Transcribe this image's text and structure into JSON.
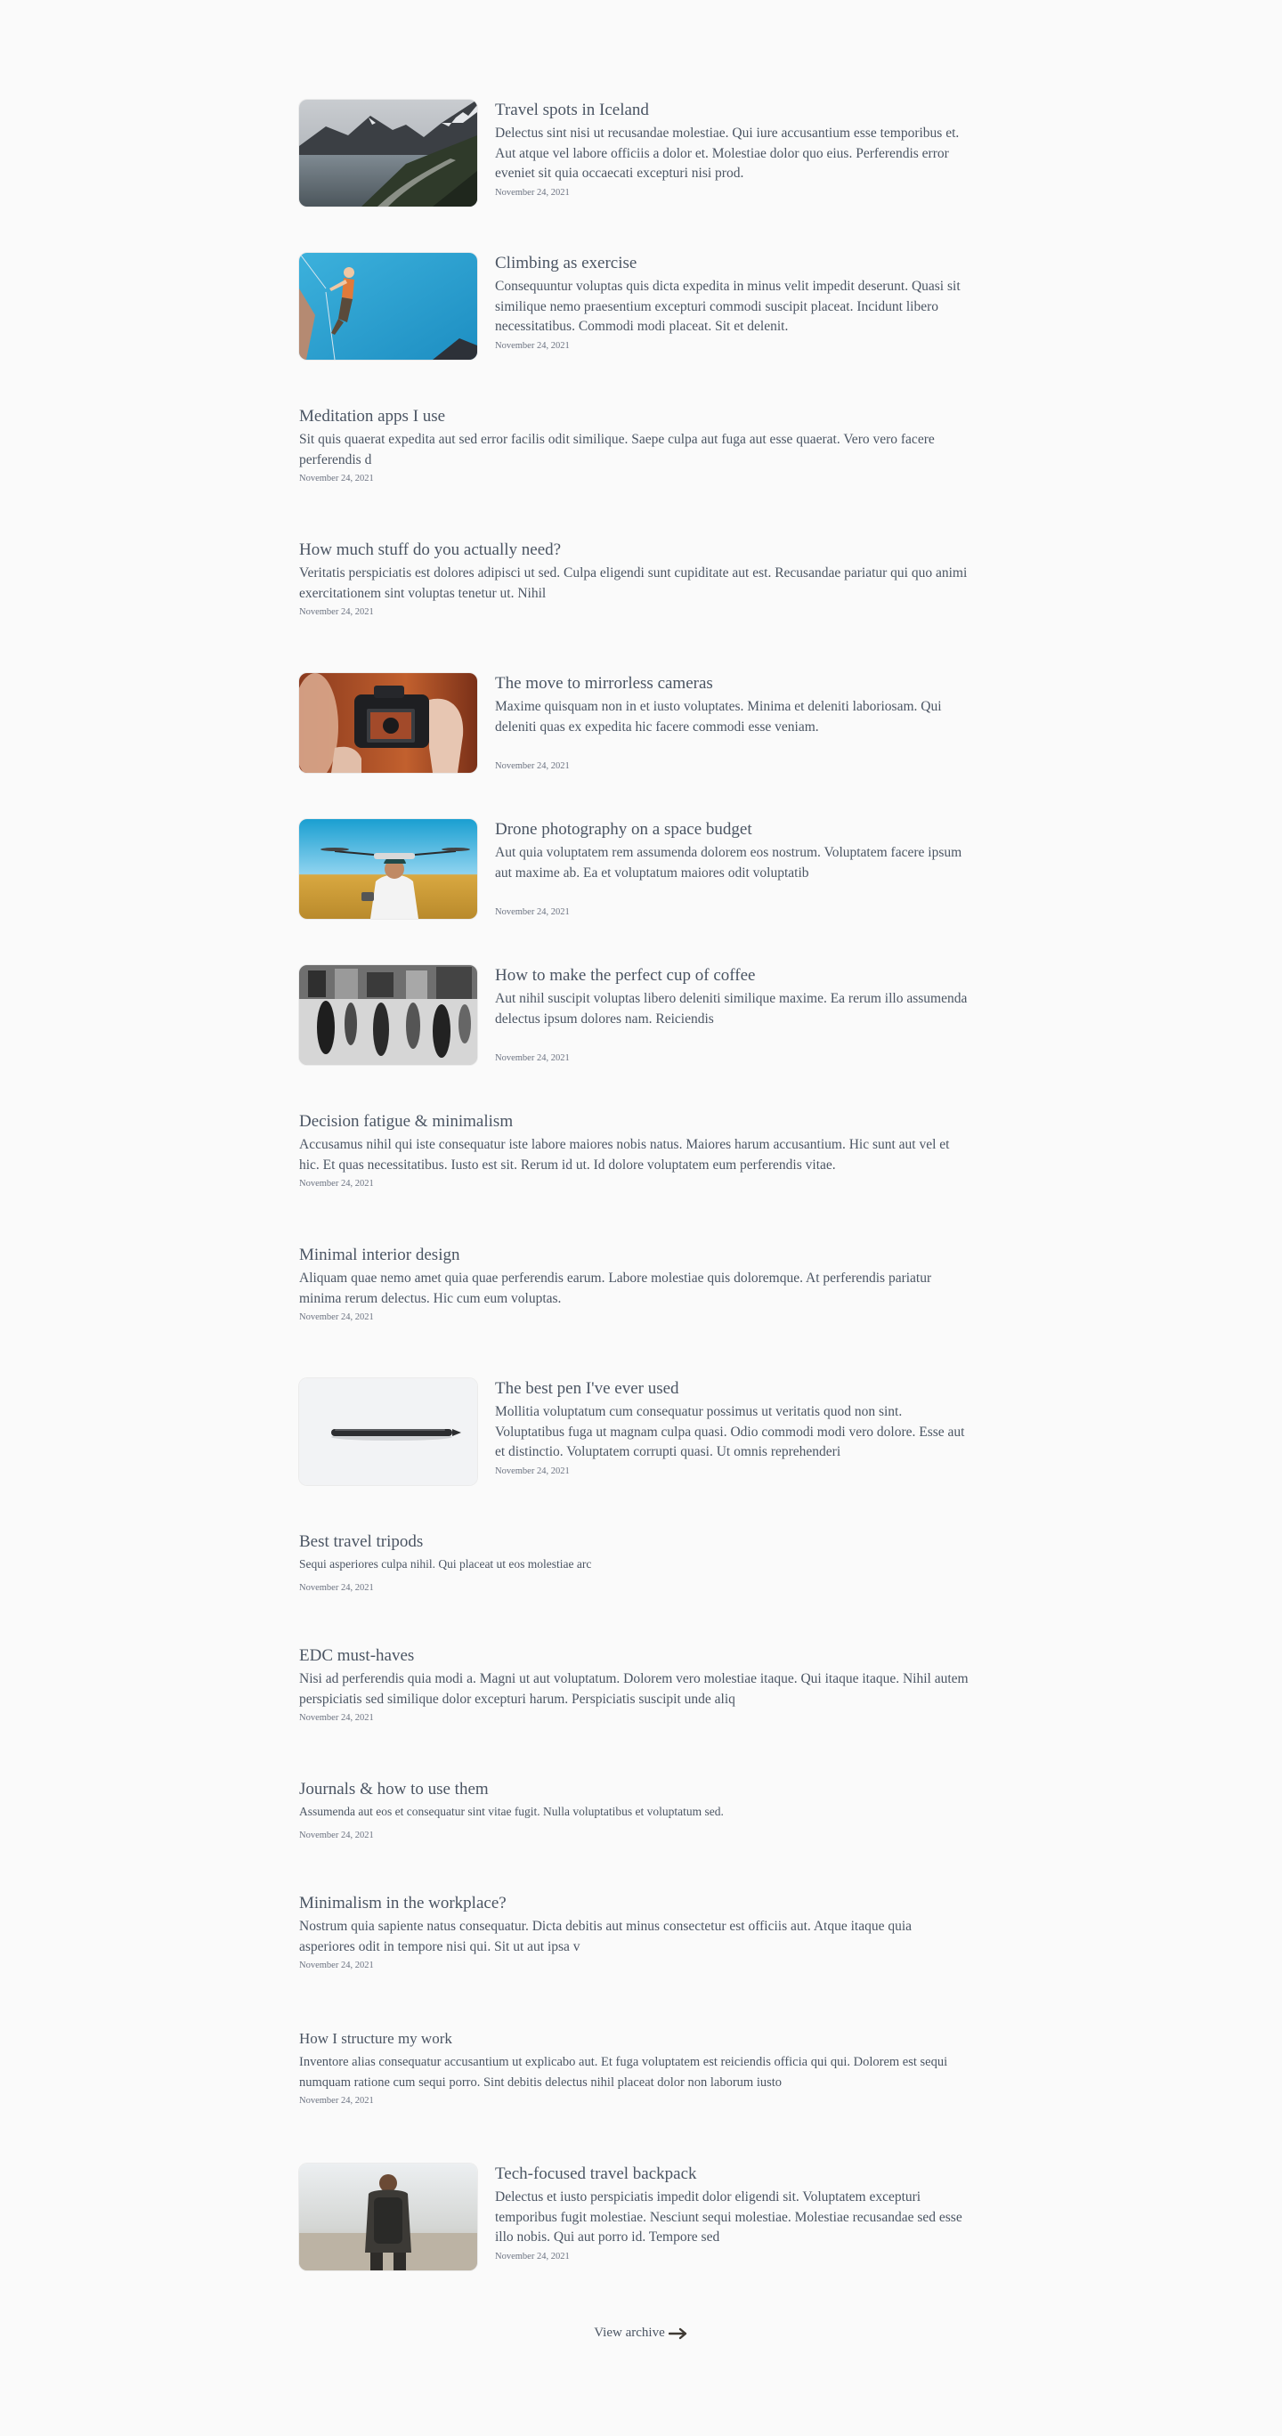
{
  "posts": [
    {
      "title": "Travel spots in Iceland",
      "excerpt": "Delectus sint nisi ut recusandae molestiae. Qui iure accusantium esse temporibus et. Aut atque vel labore officiis a dolor et. Molestiae dolor quo eius. Perferendis error eveniet sit quia occaecati excepturi nisi prod.",
      "date": "November 24, 2021",
      "image": "iceland-mountain-road"
    },
    {
      "title": "Climbing as exercise",
      "excerpt": "Consequuntur voluptas quis dicta expedita in minus velit impedit deserunt. Quasi sit similique nemo praesentium excepturi commodi suscipit placeat. Incidunt libero necessitatibus. Commodi modi placeat. Sit et delenit.",
      "date": "November 24, 2021",
      "image": "rock-climber"
    },
    {
      "title": "Meditation apps I use",
      "excerpt": "Sit quis quaerat expedita aut sed error facilis odit similique. Saepe culpa aut fuga aut esse quaerat. Vero vero facere perferendis d",
      "date": "November 24, 2021"
    },
    {
      "title": "How much stuff do you actually need?",
      "excerpt": "Veritatis perspiciatis est dolores adipisci ut sed. Culpa eligendi sunt cupiditate aut est. Recusandae pariatur qui quo animi exercitationem sint voluptas tenetur ut. Nihil",
      "date": "November 24, 2021"
    },
    {
      "title": "The move to mirrorless cameras",
      "excerpt": "Maxime quisquam non in et iusto voluptates. Minima et deleniti laboriosam. Qui deleniti quas ex expedita hic facere commodi esse veniam.",
      "date": "November 24, 2021",
      "image": "mirrorless-camera"
    },
    {
      "title": "Drone photography on a space budget",
      "excerpt": "Aut quia voluptatem rem assumenda dolorem eos nostrum. Voluptatem facere ipsum aut maxime ab. Ea et voluptatum maiores odit voluptatib",
      "date": "November 24, 2021",
      "image": "drone-pilot"
    },
    {
      "title": "How to make the perfect cup of coffee",
      "excerpt": "Aut nihil suscipit voluptas libero deleniti similique maxime. Ea rerum illo assumenda delectus ipsum dolores nam. Reiciendis",
      "date": "November 24, 2021",
      "image": "busy-street"
    },
    {
      "title": "Decision fatigue & minimalism",
      "excerpt": "Accusamus nihil qui iste consequatur iste labore maiores nobis natus. Maiores harum accusantium. Hic sunt aut vel et hic. Et quas necessitatibus. Iusto est sit. Rerum id ut. Id dolore voluptatem eum perferendis vitae.",
      "date": "November 24, 2021"
    },
    {
      "title": "Minimal interior design",
      "excerpt": "Aliquam quae nemo amet quia quae perferendis earum. Labore molestiae quis doloremque. At perferendis pariatur minima rerum delectus. Hic cum eum voluptas.",
      "date": "November 24, 2021"
    },
    {
      "title": "The best pen I've ever used",
      "excerpt": "Mollitia voluptatum cum consequatur possimus ut veritatis quod non sint. Voluptatibus fuga ut magnam culpa quasi. Odio commodi modi vero dolore. Esse aut et distinctio. Voluptatem corrupti quasi. Ut omnis reprehenderi",
      "date": "November 24, 2021",
      "image": "pen"
    },
    {
      "title": "Best travel tripods",
      "excerpt": "Sequi asperiores culpa nihil. Qui placeat ut eos molestiae arc",
      "date": "November 24, 2021"
    },
    {
      "title": "EDC must-haves",
      "excerpt": "Nisi ad perferendis quia modi a. Magni ut aut voluptatum. Dolorem vero molestiae itaque. Qui itaque itaque. Nihil autem perspiciatis sed similique dolor excepturi harum. Perspiciatis suscipit unde aliq",
      "date": "November 24, 2021"
    },
    {
      "title": "Journals & how to use them",
      "excerpt": "Assumenda aut eos et consequatur sint vitae fugit. Nulla voluptatibus et voluptatum sed.",
      "date": "November 24, 2021"
    },
    {
      "title": "Minimalism in the workplace?",
      "excerpt": "Nostrum quia sapiente natus consequatur. Dicta debitis aut minus consectetur est officiis aut. Atque itaque quia asperiores odit in tempore nisi qui. Sit ut aut ipsa v",
      "date": "November 24, 2021"
    },
    {
      "title": "How I structure my work",
      "excerpt": "Inventore alias consequatur accusantium ut explicabo aut. Et fuga voluptatem est reiciendis officia qui qui. Dolorem est sequi numquam ratione cum sequi porro. Sint debitis delectus nihil placeat dolor non laborum iusto",
      "date": "November 24, 2021"
    },
    {
      "title": "Tech-focused travel backpack",
      "excerpt": "Delectus et iusto perspiciatis impedit dolor eligendi sit. Voluptatem excepturi temporibus fugit molestiae. Nesciunt sequi molestiae. Molestiae recusandae sed esse illo nobis. Qui aut porro id. Tempore sed",
      "date": "November 24, 2021",
      "image": "backpacker"
    }
  ],
  "archive": {
    "label": "View archive",
    "icon": "arrow-right-icon"
  },
  "colors": {
    "background": "#fafafa",
    "text": "#4b5563",
    "meta": "#6b7280"
  }
}
